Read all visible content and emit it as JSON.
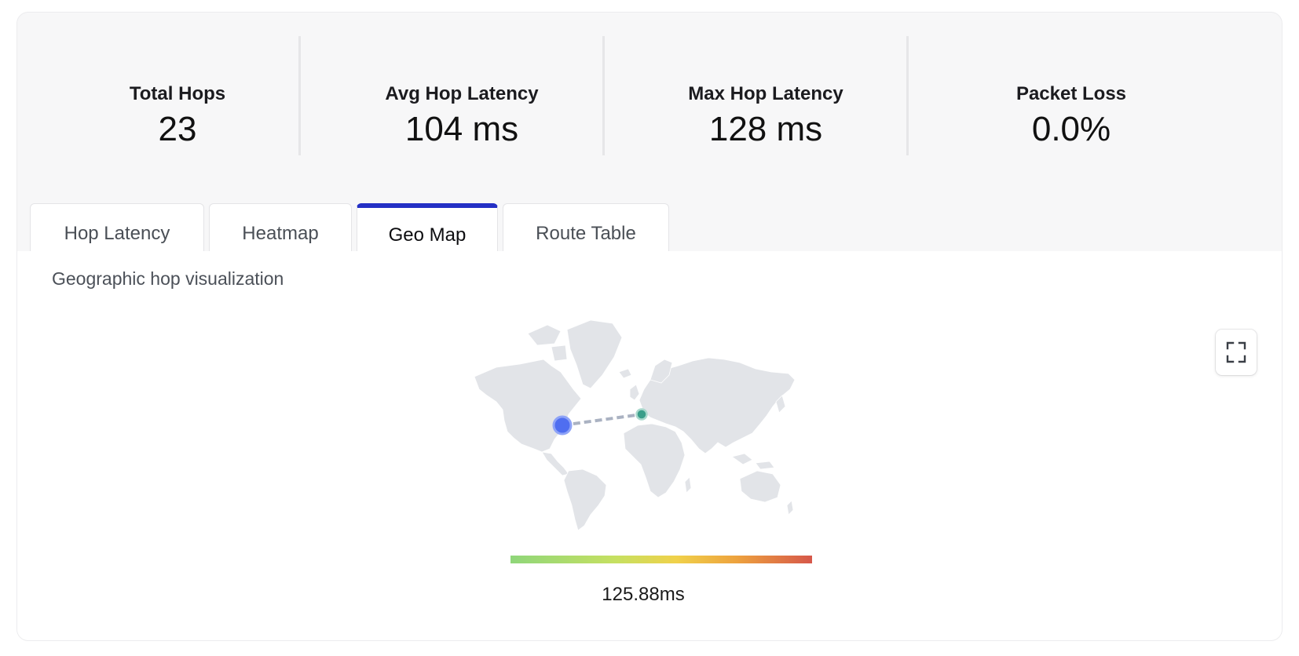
{
  "stats": [
    {
      "label": "Total Hops",
      "value": "23"
    },
    {
      "label": "Avg Hop Latency",
      "value": "104 ms"
    },
    {
      "label": "Max Hop Latency",
      "value": "128 ms"
    },
    {
      "label": "Packet Loss",
      "value": "0.0%"
    }
  ],
  "tabs": [
    {
      "label": "Hop Latency",
      "active": false
    },
    {
      "label": "Heatmap",
      "active": false
    },
    {
      "label": "Geo Map",
      "active": true
    },
    {
      "label": "Route Table",
      "active": false
    }
  ],
  "geo": {
    "subtitle": "Geographic hop visualization",
    "scale_label": "125.88ms",
    "scale_colors": [
      "#8fd67a",
      "#f0d14a",
      "#d6574a"
    ],
    "source_marker_color": "#4f6ef0",
    "dest_marker_color": "#3a9e8a",
    "fullscreen_icon": "expand-icon"
  },
  "colors": {
    "accent": "#2430c5",
    "land": "#e2e4e8"
  }
}
